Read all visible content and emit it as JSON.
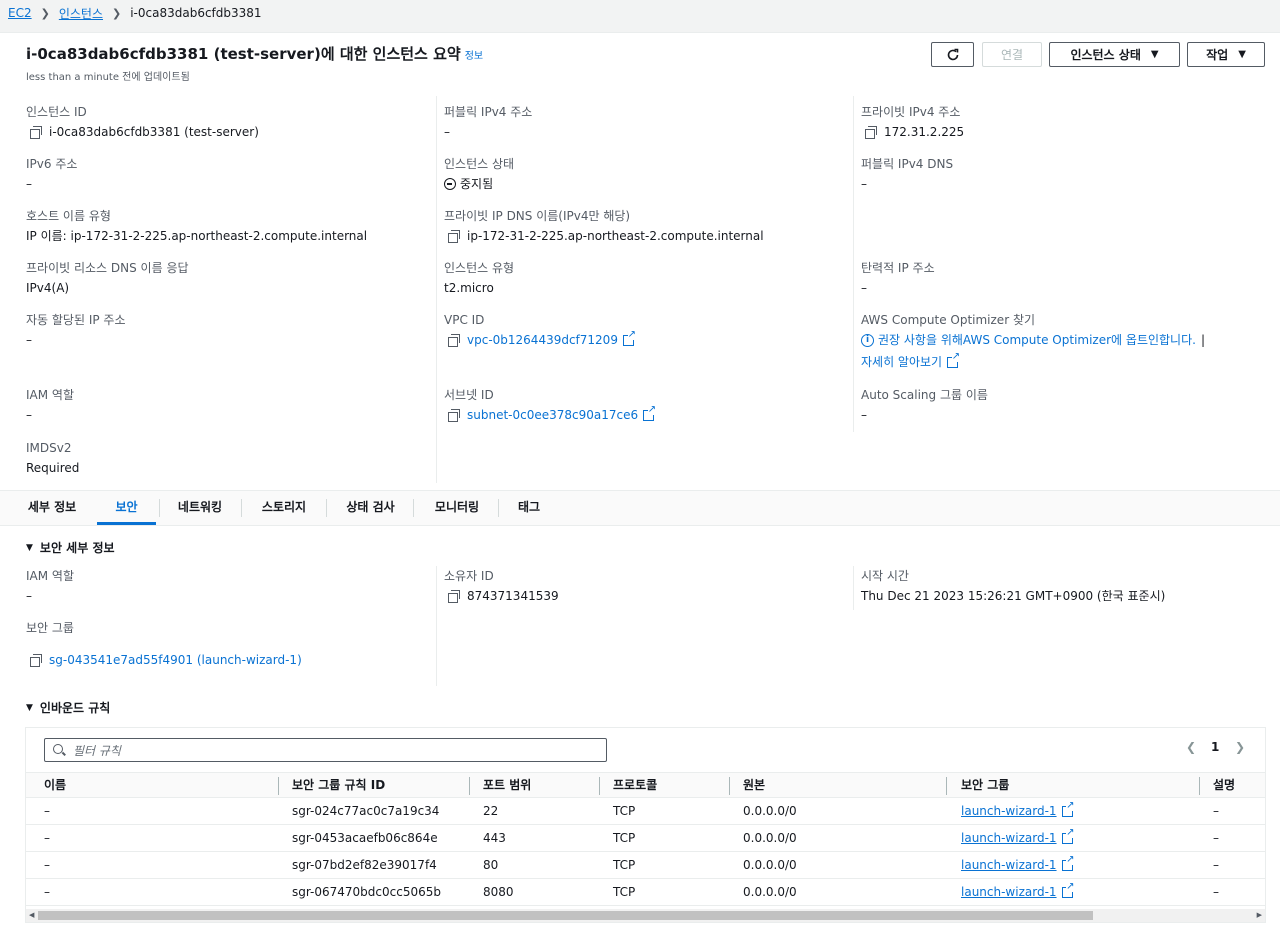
{
  "breadcrumb": {
    "root": "EC2",
    "instances": "인스턴스",
    "current": "i-0ca83dab6cfdb3381"
  },
  "header": {
    "title": "i-0ca83dab6cfdb3381 (test-server)에 대한 인스턴스 요약",
    "info": "정보",
    "updated": "less than a minute 전에 업데이트됨",
    "connect_label": "연결",
    "state_label": "인스턴스 상태",
    "actions_label": "작업"
  },
  "summary": {
    "instance_id": {
      "label": "인스턴스 ID",
      "value": "i-0ca83dab6cfdb3381 (test-server)"
    },
    "ipv6": {
      "label": "IPv6 주소",
      "value": "–"
    },
    "hostname_type": {
      "label": "호스트 이름 유형",
      "value": "IP 이름: ip-172-31-2-225.ap-northeast-2.compute.internal"
    },
    "resource_dns": {
      "label": "프라이빗 리소스 DNS 이름 응답",
      "value": "IPv4(A)"
    },
    "auto_ip": {
      "label": "자동 할당된 IP 주소",
      "value": "–"
    },
    "iam_role": {
      "label": "IAM 역할",
      "value": "–"
    },
    "imdsv2": {
      "label": "IMDSv2",
      "value": "Required"
    },
    "public_ipv4": {
      "label": "퍼블릭 IPv4 주소",
      "value": "–"
    },
    "instance_state": {
      "label": "인스턴스 상태",
      "value": "중지됨"
    },
    "private_dns": {
      "label": "프라이빗 IP DNS 이름(IPv4만 해당)",
      "value": "ip-172-31-2-225.ap-northeast-2.compute.internal"
    },
    "instance_type": {
      "label": "인스턴스 유형",
      "value": "t2.micro"
    },
    "vpc_id": {
      "label": "VPC ID",
      "value": "vpc-0b1264439dcf71209"
    },
    "subnet_id": {
      "label": "서브넷 ID",
      "value": "subnet-0c0ee378c90a17ce6"
    },
    "private_ipv4": {
      "label": "프라이빗 IPv4 주소",
      "value": "172.31.2.225"
    },
    "public_dns": {
      "label": "퍼블릭 IPv4 DNS",
      "value": "–"
    },
    "elastic_ip": {
      "label": "탄력적 IP 주소",
      "value": "–"
    },
    "optimizer": {
      "label": "AWS Compute Optimizer 찾기",
      "pre": "권장 사항을 위해 ",
      "link": "AWS Compute Optimizer",
      "post": "에 옵트인합니다.",
      "bar": "|",
      "learn_more": "자세히 알아보기"
    },
    "asg": {
      "label": "Auto Scaling 그룹 이름",
      "value": "–"
    }
  },
  "tabs": [
    "세부 정보",
    "보안",
    "네트워킹",
    "스토리지",
    "상태 검사",
    "모니터링",
    "태그"
  ],
  "security": {
    "section_title": "보안 세부 정보",
    "iam_role": {
      "label": "IAM 역할",
      "value": "–"
    },
    "security_groups": {
      "label": "보안 그룹",
      "value": "sg-043541e7ad55f4901 (launch-wizard-1)"
    },
    "owner_id": {
      "label": "소유자 ID",
      "value": "874371341539"
    },
    "launch_time": {
      "label": "시작 시간",
      "value": "Thu Dec 21 2023 15:26:21 GMT+0900 (한국 표준시)"
    }
  },
  "inbound": {
    "section_title": "인바운드 규칙",
    "filter_placeholder": "필터 규칙",
    "page": "1",
    "columns": [
      "이름",
      "보안 그룹 규칙 ID",
      "포트 범위",
      "프로토콜",
      "원본",
      "보안 그룹",
      "설명"
    ],
    "rows": [
      [
        "–",
        "sgr-024c77ac0c7a19c34",
        "22",
        "TCP",
        "0.0.0.0/0",
        "launch-wizard-1",
        "–"
      ],
      [
        "–",
        "sgr-0453acaefb06c864e",
        "443",
        "TCP",
        "0.0.0.0/0",
        "launch-wizard-1",
        "–"
      ],
      [
        "–",
        "sgr-07bd2ef82e39017f4",
        "80",
        "TCP",
        "0.0.0.0/0",
        "launch-wizard-1",
        "–"
      ],
      [
        "–",
        "sgr-067470bdc0cc5065b",
        "8080",
        "TCP",
        "0.0.0.0/0",
        "launch-wizard-1",
        "–"
      ]
    ]
  }
}
